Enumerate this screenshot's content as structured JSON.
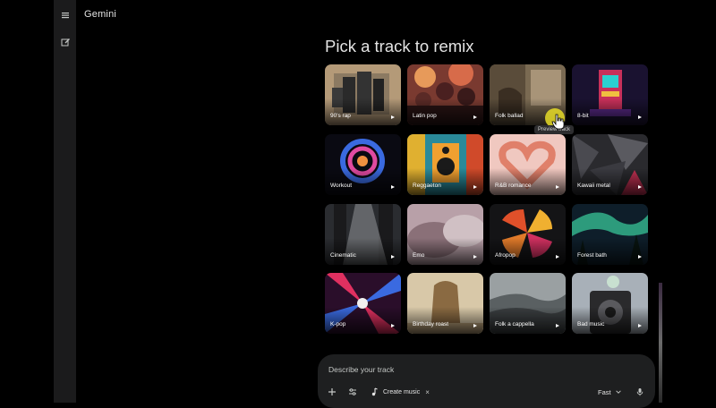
{
  "app": {
    "title": "Gemini"
  },
  "main": {
    "heading": "Pick a track to remix"
  },
  "tracks": [
    {
      "label": "90's rap"
    },
    {
      "label": "Latin pop"
    },
    {
      "label": "Folk ballad"
    },
    {
      "label": "8-bit"
    },
    {
      "label": "Workout"
    },
    {
      "label": "Reggaeton"
    },
    {
      "label": "R&B romance"
    },
    {
      "label": "Kawaii metal"
    },
    {
      "label": "Cinematic"
    },
    {
      "label": "Emo"
    },
    {
      "label": "Afropop"
    },
    {
      "label": "Forest bath"
    },
    {
      "label": "K-pop"
    },
    {
      "label": "Birthday roast"
    },
    {
      "label": "Folk a cappella"
    },
    {
      "label": "Bad music"
    }
  ],
  "tooltip": {
    "text": "Preview track"
  },
  "composer": {
    "placeholder": "Describe your track",
    "chip_label": "Create music",
    "chip_close": "×",
    "mode": "Fast"
  },
  "icons": {
    "menu": "menu-icon",
    "new_chat": "edit-icon",
    "plus": "plus-icon",
    "tools": "tune-icon",
    "music": "music-note-icon",
    "chevron": "chevron-down-icon",
    "mic": "mic-icon"
  },
  "colors": {
    "background": "#000000",
    "rail": "#1b1b1c",
    "composer": "#1e1f20",
    "cursor_highlight": "#e6dc28"
  }
}
